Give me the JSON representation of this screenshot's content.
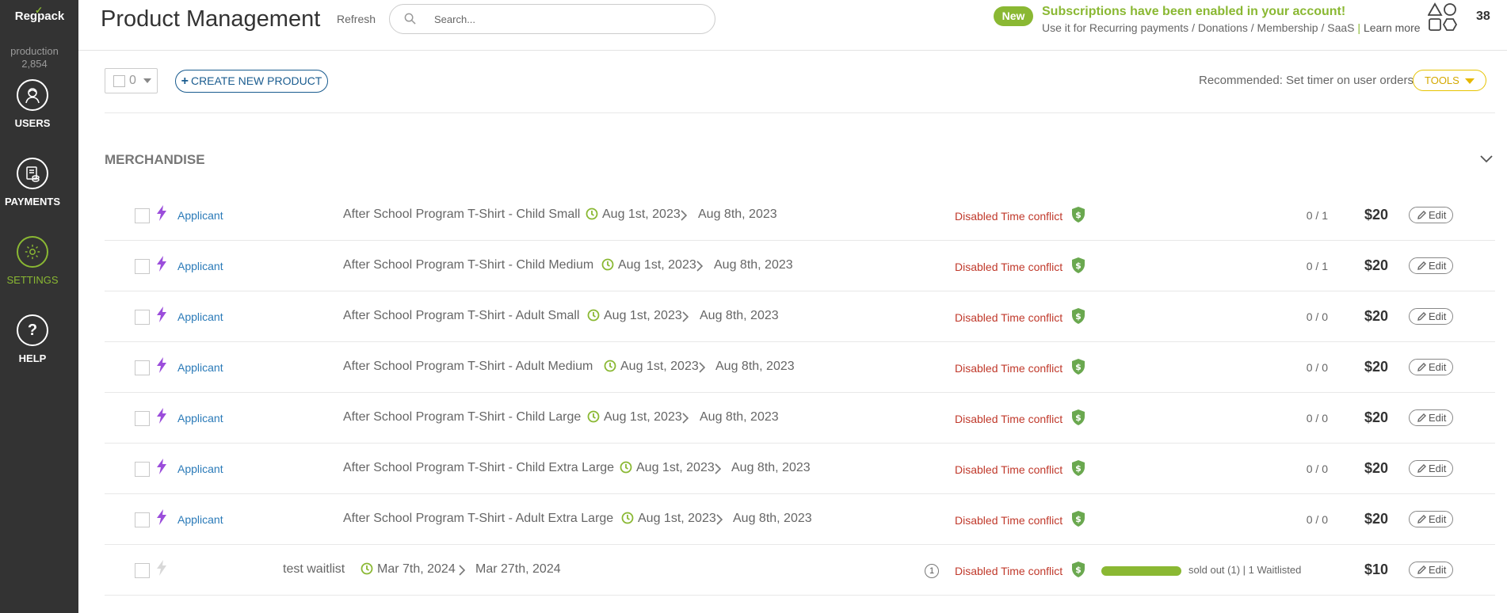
{
  "sidebar": {
    "logo": "Regpack",
    "env_name": "production",
    "env_count": "2,854",
    "items": [
      {
        "label": "USERS",
        "icon": "user-icon"
      },
      {
        "label": "PAYMENTS",
        "icon": "payments-icon"
      },
      {
        "label": "SETTINGS",
        "icon": "gear-icon",
        "active": true
      },
      {
        "label": "HELP",
        "icon": "help-icon"
      }
    ]
  },
  "header": {
    "title": "Product Management",
    "refresh": "Refresh",
    "search_placeholder": "Search...",
    "new_badge": "New",
    "announcement_title": "Subscriptions have been enabled in your account!",
    "announcement_text": "Use it for Recurring payments / Donations / Membership / SaaS",
    "separator": "|",
    "learn_more": "Learn more",
    "count": "38"
  },
  "toolbar": {
    "selected_count": "0",
    "create_button": "CREATE NEW PRODUCT",
    "recommendation": "Recommended: Set timer on user orders",
    "tools_button": "TOOLS"
  },
  "section": {
    "title": "MERCHANDISE"
  },
  "products": [
    {
      "type": "Applicant",
      "name": "After School Program T-Shirt - Child Small",
      "start": "Aug 1st, 2023",
      "end": "Aug 8th, 2023",
      "status": "Disabled Time conflict",
      "qty": "0 / 1",
      "price": "$20",
      "edit": "Edit"
    },
    {
      "type": "Applicant",
      "name": "After School Program T-Shirt - Child Medium",
      "start": "Aug 1st, 2023",
      "end": "Aug 8th, 2023",
      "status": "Disabled Time conflict",
      "qty": "0 / 1",
      "price": "$20",
      "edit": "Edit"
    },
    {
      "type": "Applicant",
      "name": "After School Program T-Shirt - Adult Small",
      "start": "Aug 1st, 2023",
      "end": "Aug 8th, 2023",
      "status": "Disabled Time conflict",
      "qty": "0 / 0",
      "price": "$20",
      "edit": "Edit"
    },
    {
      "type": "Applicant",
      "name": "After School Program T-Shirt - Adult Medium",
      "start": "Aug 1st, 2023",
      "end": "Aug 8th, 2023",
      "status": "Disabled Time conflict",
      "qty": "0 / 0",
      "price": "$20",
      "edit": "Edit"
    },
    {
      "type": "Applicant",
      "name": "After School Program T-Shirt - Child Large",
      "start": "Aug 1st, 2023",
      "end": "Aug 8th, 2023",
      "status": "Disabled Time conflict",
      "qty": "0 / 0",
      "price": "$20",
      "edit": "Edit"
    },
    {
      "type": "Applicant",
      "name": "After School Program T-Shirt - Child Extra Large",
      "start": "Aug 1st, 2023",
      "end": "Aug 8th, 2023",
      "status": "Disabled Time conflict",
      "qty": "0 / 0",
      "price": "$20",
      "edit": "Edit"
    },
    {
      "type": "Applicant",
      "name": "After School Program T-Shirt - Adult Extra Large",
      "start": "Aug 1st, 2023",
      "end": "Aug 8th, 2023",
      "status": "Disabled Time conflict",
      "qty": "0 / 0",
      "price": "$20",
      "edit": "Edit"
    },
    {
      "type": "",
      "name": "test waitlist",
      "start": "Mar 7th, 2024",
      "end": "Mar 27th, 2024",
      "waitlist_count": "1",
      "status": "Disabled Time conflict",
      "sold_out": "sold out (1) | 1 Waitlisted",
      "sold_fraction": 1.0,
      "price": "$10",
      "edit": "Edit"
    }
  ],
  "colors": {
    "accent_green": "#8ab833",
    "link_blue": "#2a7ab8",
    "status_red": "#c0392b",
    "bolt_purple": "#9b4ddb",
    "tools_yellow": "#e6c300",
    "sidebar_bg": "#333333"
  }
}
